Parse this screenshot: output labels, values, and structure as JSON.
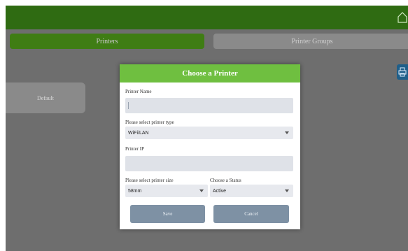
{
  "tabs": {
    "printers": "Printers",
    "printer_groups": "Printer Groups"
  },
  "default_card": {
    "label": "Default"
  },
  "modal": {
    "title": "Choose a Printer",
    "printer_name_label": "Printer Name",
    "printer_name_value": "",
    "printer_type_label": "Please select printer type",
    "printer_type_value": "WiFi/LAN",
    "printer_ip_label": "Printer IP",
    "printer_ip_value": "",
    "printer_size_label": "Please select printer size",
    "printer_size_value": "58mm",
    "status_label": "Choose a Status",
    "status_value": "Active",
    "save_label": "Save",
    "cancel_label": "Cancel"
  },
  "icons": {
    "top_right": "home-icon",
    "side": "printer-icon"
  },
  "colors": {
    "topbar": "#2f6b12",
    "tab_active": "#3f7d14",
    "modal_header": "#6fbf40",
    "button": "#7e91a4"
  }
}
